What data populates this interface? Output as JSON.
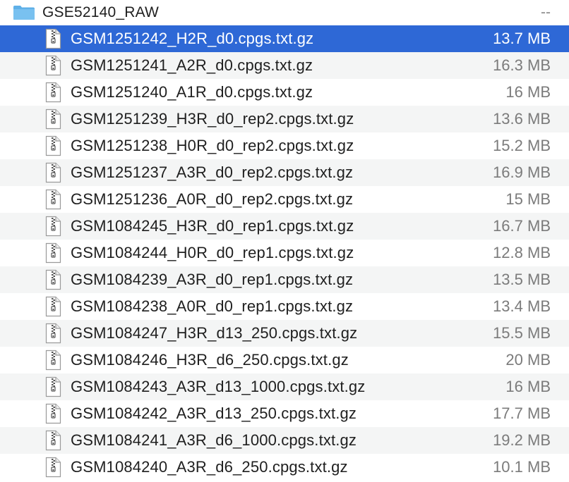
{
  "folder": {
    "name": "GSE52140_RAW",
    "size": "--",
    "icon": "folder-icon",
    "icon_color": "#5fb0e8"
  },
  "selected_color": "#2e68d6",
  "files": [
    {
      "name": "GSM1251242_H2R_d0.cpgs.txt.gz",
      "size": "13.7 MB",
      "icon": "zip-file-icon"
    },
    {
      "name": "GSM1251241_A2R_d0.cpgs.txt.gz",
      "size": "16.3 MB",
      "icon": "zip-file-icon"
    },
    {
      "name": "GSM1251240_A1R_d0.cpgs.txt.gz",
      "size": "16 MB",
      "icon": "zip-file-icon"
    },
    {
      "name": "GSM1251239_H3R_d0_rep2.cpgs.txt.gz",
      "size": "13.6 MB",
      "icon": "zip-file-icon"
    },
    {
      "name": "GSM1251238_H0R_d0_rep2.cpgs.txt.gz",
      "size": "15.2 MB",
      "icon": "zip-file-icon"
    },
    {
      "name": "GSM1251237_A3R_d0_rep2.cpgs.txt.gz",
      "size": "16.9 MB",
      "icon": "zip-file-icon"
    },
    {
      "name": "GSM1251236_A0R_d0_rep2.cpgs.txt.gz",
      "size": "15 MB",
      "icon": "zip-file-icon"
    },
    {
      "name": "GSM1084245_H3R_d0_rep1.cpgs.txt.gz",
      "size": "16.7 MB",
      "icon": "zip-file-icon"
    },
    {
      "name": "GSM1084244_H0R_d0_rep1.cpgs.txt.gz",
      "size": "12.8 MB",
      "icon": "zip-file-icon"
    },
    {
      "name": "GSM1084239_A3R_d0_rep1.cpgs.txt.gz",
      "size": "13.5 MB",
      "icon": "zip-file-icon"
    },
    {
      "name": "GSM1084238_A0R_d0_rep1.cpgs.txt.gz",
      "size": "13.4 MB",
      "icon": "zip-file-icon"
    },
    {
      "name": "GSM1084247_H3R_d13_250.cpgs.txt.gz",
      "size": "15.5 MB",
      "icon": "zip-file-icon"
    },
    {
      "name": "GSM1084246_H3R_d6_250.cpgs.txt.gz",
      "size": "20 MB",
      "icon": "zip-file-icon"
    },
    {
      "name": "GSM1084243_A3R_d13_1000.cpgs.txt.gz",
      "size": "16 MB",
      "icon": "zip-file-icon"
    },
    {
      "name": "GSM1084242_A3R_d13_250.cpgs.txt.gz",
      "size": "17.7 MB",
      "icon": "zip-file-icon"
    },
    {
      "name": "GSM1084241_A3R_d6_1000.cpgs.txt.gz",
      "size": "19.2 MB",
      "icon": "zip-file-icon"
    },
    {
      "name": "GSM1084240_A3R_d6_250.cpgs.txt.gz",
      "size": "10.1 MB",
      "icon": "zip-file-icon"
    }
  ]
}
